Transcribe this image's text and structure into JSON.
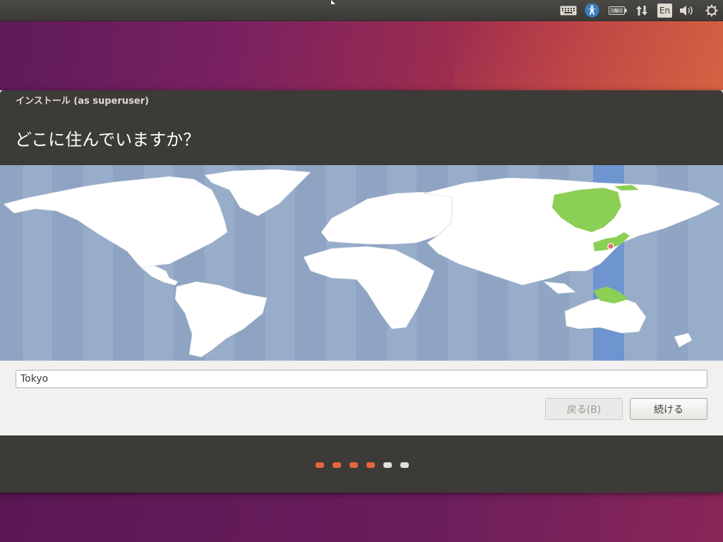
{
  "window": {
    "title": "インストール (as superuser)",
    "heading": "どこに住んでいますか？"
  },
  "location": {
    "value": "Tokyo",
    "selected_timezone": "Asia/Tokyo"
  },
  "buttons": {
    "back_label": "戻る(B)",
    "continue_label": "続ける"
  },
  "progress": {
    "total_steps": 6,
    "completed_steps": 4
  },
  "indicators": {
    "keyboard_layout": "En"
  },
  "colors": {
    "map_ocean": "#97adca",
    "map_land": "#ffffff",
    "selected_zone": "#6e95d0",
    "selected_country": "#8ccf55",
    "progress_done": "#e2683a",
    "progress_todo": "#e2e0dc"
  }
}
